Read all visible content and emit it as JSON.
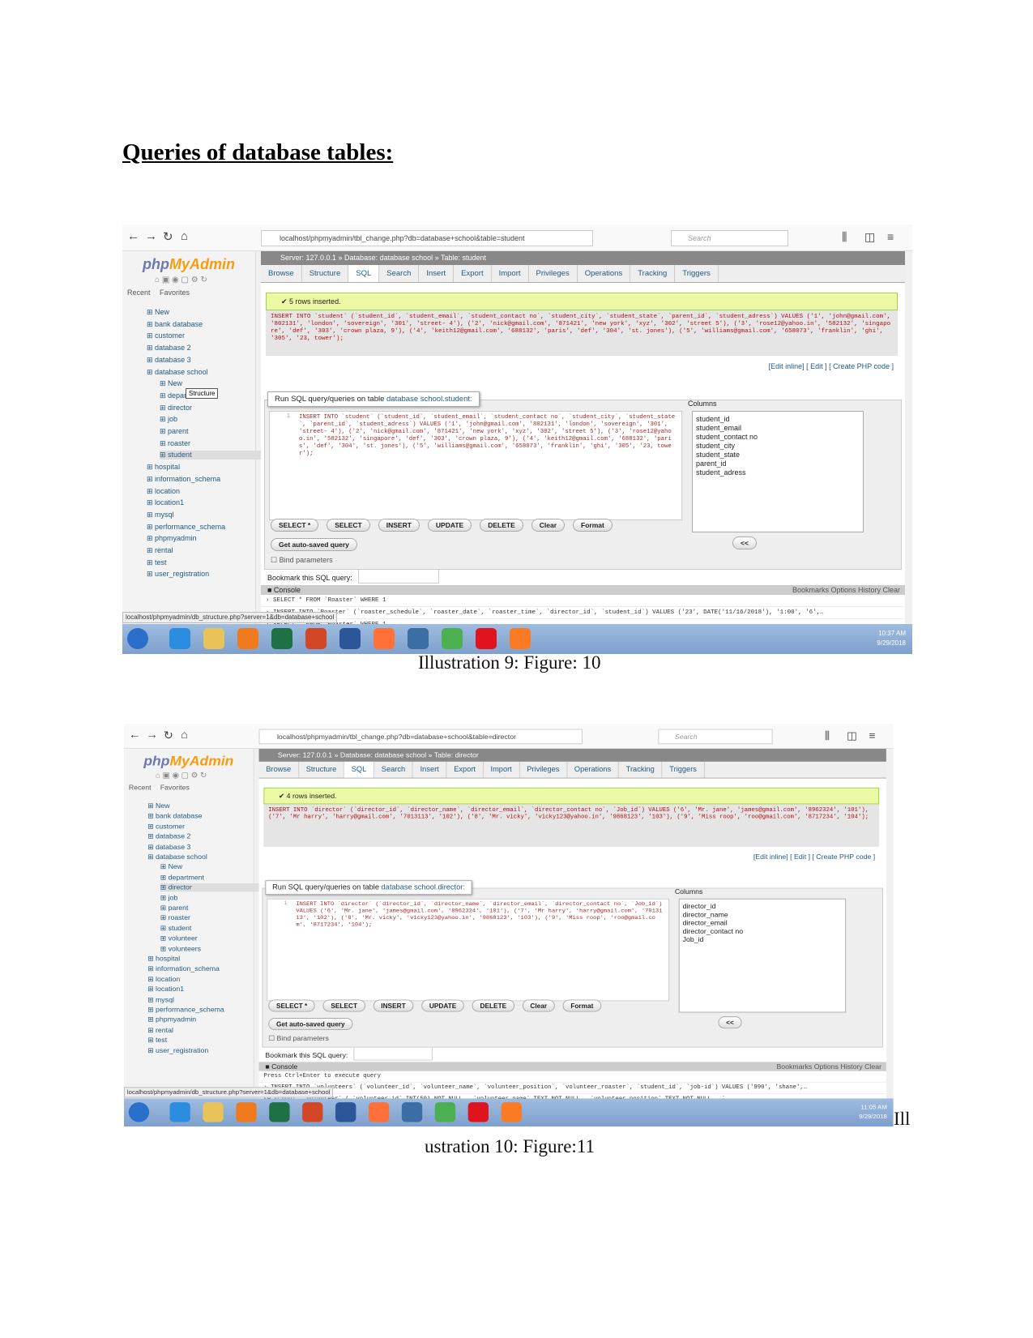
{
  "document": {
    "heading": "Queries of database tables:"
  },
  "figures": [
    {
      "caption": "Illustration 9: Figure: 10",
      "url": "localhost/phpmyadmin/tbl_change.php?db=database+school&table=student",
      "search_placeholder": "Search",
      "logo": {
        "a": "php",
        "b": "MyAdmin"
      },
      "recent": "Recent",
      "favorites": "Favorites",
      "breadcrumb": "Server: 127.0.0.1 » Database: database school » Table: student",
      "tabs": [
        "Browse",
        "Structure",
        "SQL",
        "Search",
        "Insert",
        "Export",
        "Import",
        "Privileges",
        "Operations",
        "Tracking",
        "Triggers"
      ],
      "active_tab": "SQL",
      "tree": [
        {
          "t": "New"
        },
        {
          "t": "bank database"
        },
        {
          "t": "customer"
        },
        {
          "t": "database 2"
        },
        {
          "t": "database 3"
        },
        {
          "t": "database school"
        },
        {
          "t": "New",
          "sub": true
        },
        {
          "t": "department",
          "sub": true
        },
        {
          "t": "director",
          "sub": true
        },
        {
          "t": "job",
          "sub": true
        },
        {
          "t": "parent",
          "sub": true
        },
        {
          "t": "roaster",
          "sub": true
        },
        {
          "t": "student",
          "sub": true,
          "sel": true
        },
        {
          "t": "hospital"
        },
        {
          "t": "information_schema"
        },
        {
          "t": "location"
        },
        {
          "t": "location1"
        },
        {
          "t": "mysql"
        },
        {
          "t": "performance_schema"
        },
        {
          "t": "phpmyadmin"
        },
        {
          "t": "rental"
        },
        {
          "t": "test"
        },
        {
          "t": "user_registration"
        }
      ],
      "tooltip": "Structure",
      "success": "5 rows inserted.",
      "sql_output": "INSERT INTO `student` (`student_id`, `student_email`, `student_contact no`, `student_city`, `student_state`, `parent_id`, `student_adress`) VALUES ('1', 'john@gmail.com', '802131', 'london', 'sovereign', '301', 'street- 4'), ('2', 'nick@gmail.com', '871421', 'new york', 'xyz', '302', 'street 5'), ('3', 'rose12@yahoo.in', '582132', 'singapore', 'def', '303', 'crown plaza, 9'), ('4', 'keith12@gmail.com', '688132', 'paris', 'def', '304', 'st. jones'), ('5', 'williams@gmail.com', '658073', 'franklin', 'ghi', '305', '23, tower');",
      "links": "[Edit inline] [ Edit ] [ Create PHP code ]",
      "query_label": "Run SQL query/queries on table ",
      "query_table": "database school.student:",
      "editor": "INSERT INTO `student` (`student_id`, `student_email`, `student_contact no`, `student_city`, `student_state`, `parent_id`, `student_adress`) VALUES ('1', 'john@gmail.com', '802131', 'london', 'sovereign', '301', 'street- 4'), ('2', 'nick@gmail.com', '871421', 'new york', 'xyz', '302', 'street 5'), ('3', 'rose12@yahoo.in', '582132', 'singapore', 'def', '303', 'crown plaza, 9'), ('4', 'keith12@gmail.com', '688132', 'paris', 'def', '304', 'st. jones'), ('5', 'williams@gmail.com', '658073', 'franklin', 'ghi', '305', '23, tower');",
      "columns_label": "Columns",
      "columns": [
        "student_id",
        "student_email",
        "student_contact no",
        "student_city",
        "student_state",
        "parent_id",
        "student_adress"
      ],
      "buttons": [
        "SELECT *",
        "SELECT",
        "INSERT",
        "UPDATE",
        "DELETE",
        "Clear",
        "Format"
      ],
      "insert_col": "<<",
      "autosave": "Get auto-saved query",
      "bind": "Bind parameters",
      "bookmark": "Bookmark this SQL query:",
      "console": "Console",
      "console_links": "Bookmarks   Options   History   Clear",
      "console_lines": [
        "› SELECT * FROM `Roaster` WHERE 1",
        "› INSERT INTO `Roaster` (`roaster_schedule`, `roaster_date`, `roaster_time`, `director_id`, `student_id`) VALUES ('23', DATE('11/16/2018'), '1:00', '6',…",
        "› SELECT * FROM `Roaster` WHERE 1"
      ],
      "status_url": "localhost/phpmyadmin/db_structure.php?server=1&db=database+school",
      "time": "10:37 AM",
      "date": "9/29/2018"
    },
    {
      "caption": "Illustration 10: Figure:11",
      "caption_prefix": "Ill",
      "url": "localhost/phpmyadmin/tbl_change.php?db=database+school&table=director",
      "search_placeholder": "Search",
      "logo": {
        "a": "php",
        "b": "MyAdmin"
      },
      "recent": "Recent",
      "favorites": "Favorites",
      "breadcrumb": "Server: 127.0.0.1 » Database: database school » Table: director",
      "tabs": [
        "Browse",
        "Structure",
        "SQL",
        "Search",
        "Insert",
        "Export",
        "Import",
        "Privileges",
        "Operations",
        "Tracking",
        "Triggers"
      ],
      "active_tab": "SQL",
      "tree": [
        {
          "t": "New"
        },
        {
          "t": "bank database"
        },
        {
          "t": "customer"
        },
        {
          "t": "database 2"
        },
        {
          "t": "database 3"
        },
        {
          "t": "database school"
        },
        {
          "t": "New",
          "sub": true
        },
        {
          "t": "department",
          "sub": true
        },
        {
          "t": "director",
          "sub": true,
          "sel": true
        },
        {
          "t": "job",
          "sub": true
        },
        {
          "t": "parent",
          "sub": true
        },
        {
          "t": "roaster",
          "sub": true
        },
        {
          "t": "student",
          "sub": true
        },
        {
          "t": "volunteer",
          "sub": true
        },
        {
          "t": "volunteers",
          "sub": true
        },
        {
          "t": "hospital"
        },
        {
          "t": "information_schema"
        },
        {
          "t": "location"
        },
        {
          "t": "location1"
        },
        {
          "t": "mysql"
        },
        {
          "t": "performance_schema"
        },
        {
          "t": "phpmyadmin"
        },
        {
          "t": "rental"
        },
        {
          "t": "test"
        },
        {
          "t": "user_registration"
        }
      ],
      "success": "4 rows inserted.",
      "sql_output": "INSERT INTO `director` (`director_id`, `director_name`, `director_email`, `director_contact no`, `Job_id`) VALUES ('6', 'Mr. jane', 'james@gmail.com', '8962324', '101'), ('7', 'Mr harry', 'harry@gmail.com', '7013113', '102'), ('8', 'Mr. vicky', 'vicky123@yahoo.in', '9868123', '103'), ('9', 'Miss roop', 'roo@gmail.com', '8717234', '104');",
      "links": "[Edit inline] [ Edit ] [ Create PHP code ]",
      "query_label": "Run SQL query/queries on table ",
      "query_table": "database school.director:",
      "editor": "INSERT INTO `director` (`director_id`, `director_name`, `director_email`, `director_contact no`, `Job_id`) VALUES ('6', 'Mr. jane', 'james@gmail.com', '8962324', '101'), ('7', 'Mr harry', 'harry@gmail.com', '7013113', '102'), ('8', 'Mr. vicky', 'vicky123@yahoo.in', '9868123', '103'), ('9', 'Miss roop', 'roo@gmail.com', '8717234', '104');",
      "columns_label": "Columns",
      "columns": [
        "director_id",
        "director_name",
        "director_email",
        "director_contact no",
        "Job_id"
      ],
      "buttons": [
        "SELECT *",
        "SELECT",
        "INSERT",
        "UPDATE",
        "DELETE",
        "Clear",
        "Format"
      ],
      "insert_col": "<<",
      "autosave": "Get auto-saved query",
      "bind": "Bind parameters",
      "bookmark": "Bookmark this SQL query:",
      "console": "Console",
      "console_links": "Bookmarks   Options   History   Clear",
      "console_lines": [
        "Press Ctrl+Enter to execute query",
        "› INSERT INTO `volunteers` (`volunteer_id`, `volunteer_name`, `volunteer_position`, `volunteer_roaster`, `student_id`, `job-id`) VALUES ('990', 'shane',…",
        "se school`.`volunteer` ( `volunteer_id` INT(50) NOT NULL , `volunteer_name` TEXT NOT NULL , `volunteer_position` TEXT NOT NULL , `…"
      ],
      "status_url": "localhost/phpmyadmin/db_structure.php?server=1&db=database+school",
      "time": "11:05 AM",
      "date": "9/29/2018"
    }
  ],
  "taskbar_icons": [
    "windows-start",
    "internet-explorer",
    "file-explorer",
    "media-player",
    "excel",
    "powerpoint",
    "word",
    "firefox",
    "thunderbird",
    "chrome",
    "opera",
    "xampp"
  ],
  "taskbar_colors": [
    "#2a6fc9",
    "#2b8de0",
    "#e8c35a",
    "#f07b1e",
    "#1e7145",
    "#d24726",
    "#2b579a",
    "#ff7139",
    "#3a6ea5",
    "#4caf50",
    "#e0141e",
    "#fb7a24"
  ]
}
